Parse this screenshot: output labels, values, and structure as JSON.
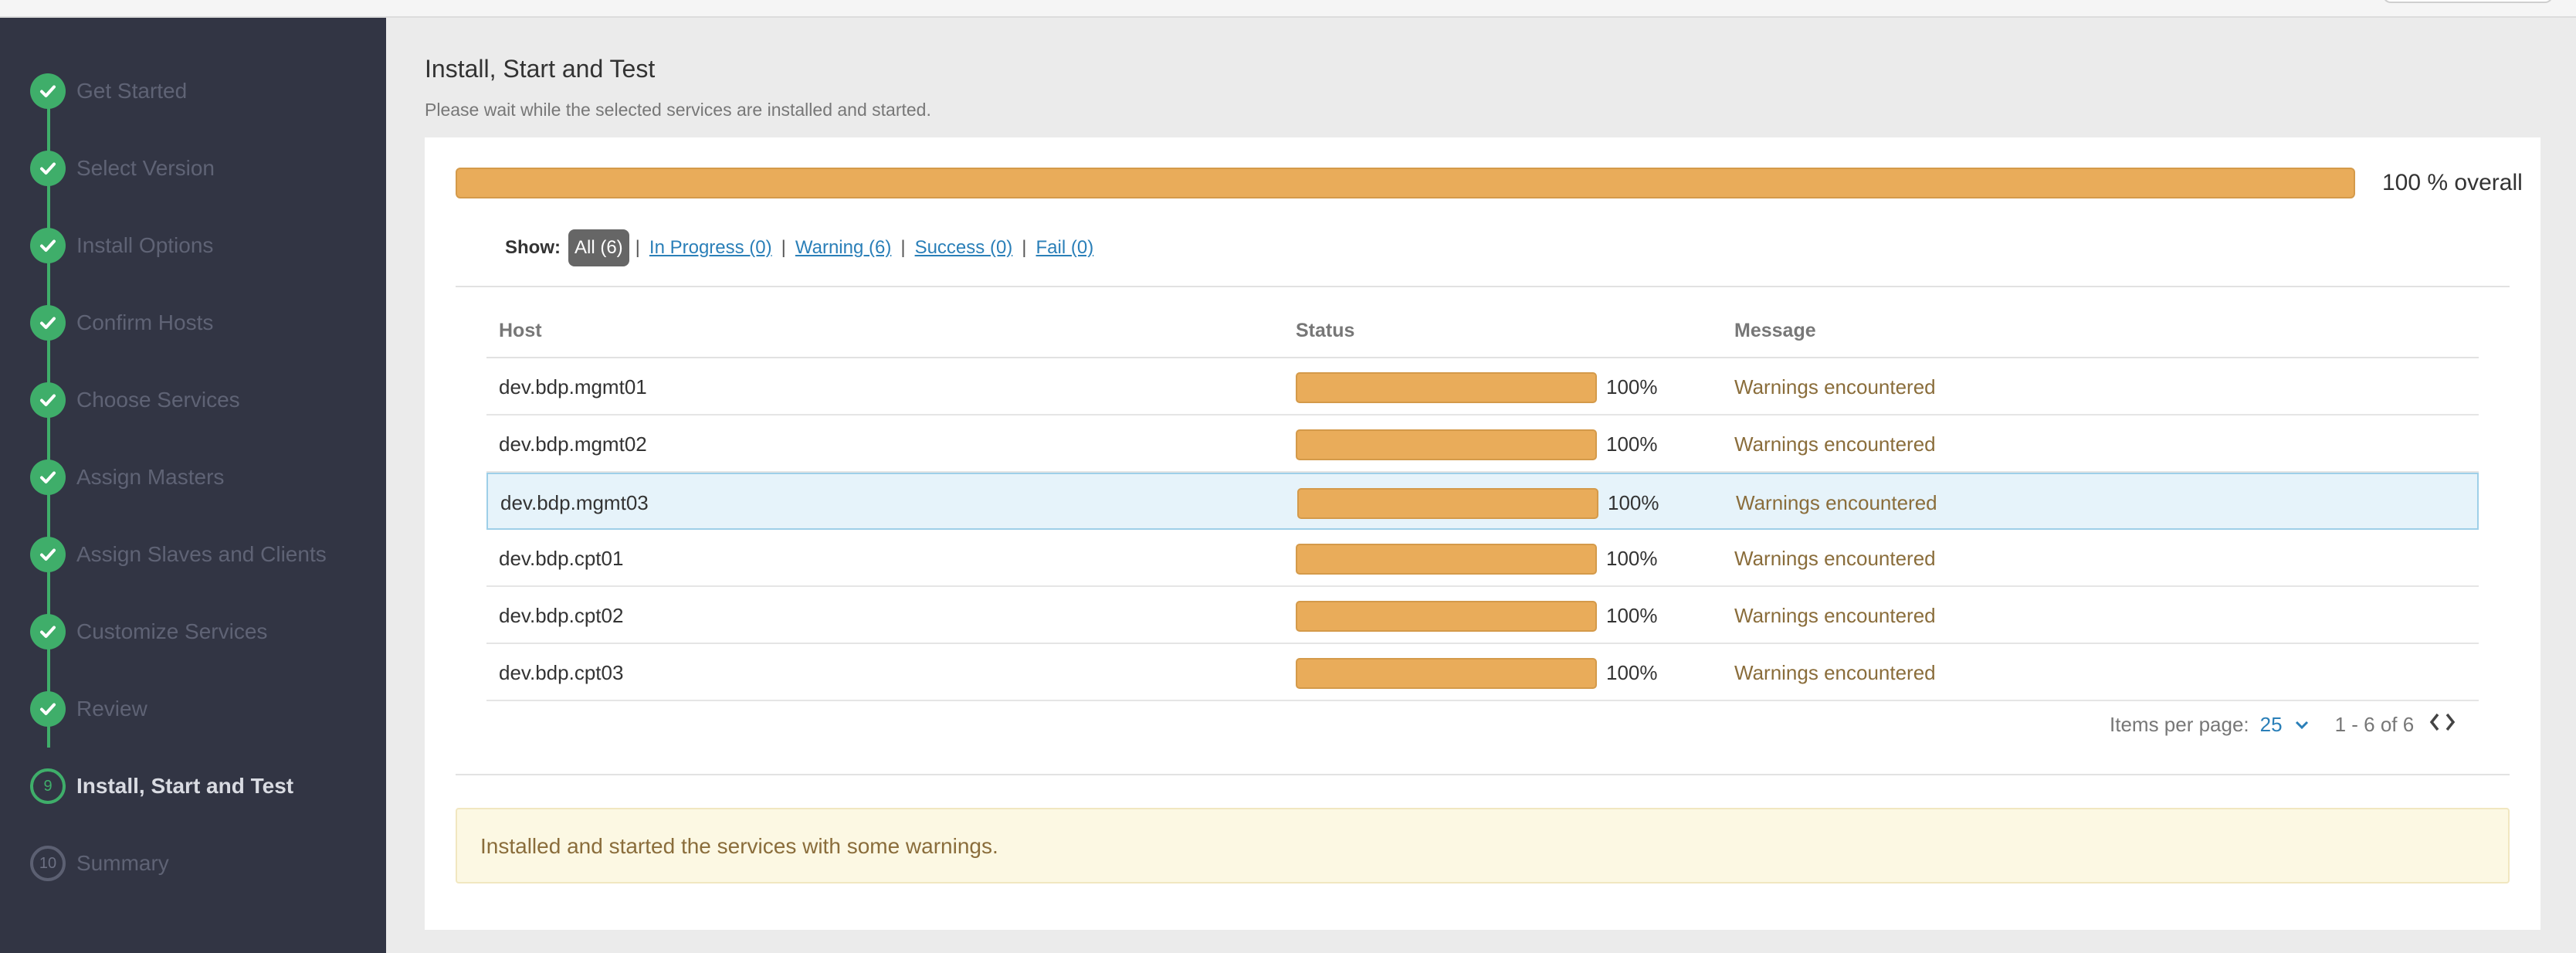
{
  "sidebar": {
    "steps": [
      {
        "label": "Get Started",
        "state": "done"
      },
      {
        "label": "Select Version",
        "state": "done"
      },
      {
        "label": "Install Options",
        "state": "done"
      },
      {
        "label": "Confirm Hosts",
        "state": "done"
      },
      {
        "label": "Choose Services",
        "state": "done"
      },
      {
        "label": "Assign Masters",
        "state": "done"
      },
      {
        "label": "Assign Slaves and Clients",
        "state": "done"
      },
      {
        "label": "Customize Services",
        "state": "done"
      },
      {
        "label": "Review",
        "state": "done"
      },
      {
        "label": "Install, Start and Test",
        "state": "current",
        "number": "9"
      },
      {
        "label": "Summary",
        "state": "todo",
        "number": "10"
      }
    ]
  },
  "page": {
    "title": "Install, Start and Test",
    "subtitle": "Please wait while the selected services are installed and started."
  },
  "overall": {
    "progress_percent": 100,
    "text": "100 % overall"
  },
  "filter": {
    "show_label": "Show:",
    "all": "All (6)",
    "separator": "|",
    "in_progress": "In Progress (0)",
    "warning": "Warning (6)",
    "success": "Success (0)",
    "fail": "Fail (0)"
  },
  "table": {
    "headers": {
      "host": "Host",
      "status": "Status",
      "message": "Message"
    },
    "rows": [
      {
        "host": "dev.bdp.mgmt01",
        "progress_percent": 100,
        "pct": "100%",
        "message": "Warnings encountered"
      },
      {
        "host": "dev.bdp.mgmt02",
        "progress_percent": 100,
        "pct": "100%",
        "message": "Warnings encountered"
      },
      {
        "host": "dev.bdp.mgmt03",
        "progress_percent": 100,
        "pct": "100%",
        "message": "Warnings encountered",
        "highlighted": true
      },
      {
        "host": "dev.bdp.cpt01",
        "progress_percent": 100,
        "pct": "100%",
        "message": "Warnings encountered"
      },
      {
        "host": "dev.bdp.cpt02",
        "progress_percent": 100,
        "pct": "100%",
        "message": "Warnings encountered"
      },
      {
        "host": "dev.bdp.cpt03",
        "progress_percent": 100,
        "pct": "100%",
        "message": "Warnings encountered"
      }
    ]
  },
  "pager": {
    "items_per_page_label": "Items per page:",
    "items_per_page": "25",
    "range": "1 - 6 of 6"
  },
  "alert": {
    "text": "Installed and started the services with some warnings."
  },
  "colors": {
    "accent_green": "#3fae6a",
    "progress_orange": "#e9ac5a",
    "sidebar_bg": "#323544",
    "link_blue": "#2a7fb8",
    "warning_text": "#8a6d3b",
    "alert_bg": "#fcf8e3"
  },
  "icons": {
    "step_done": "check-icon",
    "items_dropdown": "chevron-down-icon",
    "prev": "chevron-left-icon",
    "next": "chevron-right-icon"
  }
}
